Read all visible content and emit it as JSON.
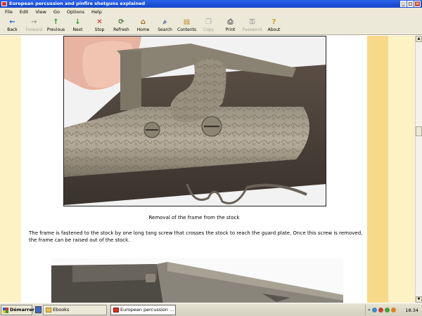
{
  "window": {
    "title": "European percussion and pinfire shotguns explained",
    "buttons": [
      "_",
      "□",
      "×"
    ]
  },
  "menu": [
    "File",
    "Edit",
    "View",
    "Go",
    "Options",
    "Help"
  ],
  "toolbar": [
    {
      "label": "Back",
      "icon": "←",
      "color": "#2a6bd0",
      "enabled": true
    },
    {
      "label": "Forward",
      "icon": "→",
      "color": "#9a9a9a",
      "enabled": false
    },
    {
      "label": "Previous",
      "icon": "↑",
      "color": "#28a028",
      "enabled": true
    },
    {
      "label": "Next",
      "icon": "↓",
      "color": "#28a028",
      "enabled": true
    },
    {
      "label": "Stop",
      "icon": "✕",
      "color": "#d82020",
      "enabled": true
    },
    {
      "label": "Refresh",
      "icon": "⟳",
      "color": "#3a7a3a",
      "enabled": true
    },
    {
      "label": "Home",
      "icon": "⌂",
      "color": "#a06a20",
      "enabled": true
    },
    {
      "label": "Search",
      "icon": "⌕",
      "color": "#2a4a8a",
      "enabled": true
    },
    {
      "label": "Contents",
      "icon": "▤",
      "color": "#b88830",
      "enabled": true
    },
    {
      "label": "Copy",
      "icon": "❐",
      "color": "#a8a8a8",
      "enabled": false
    },
    {
      "label": "Print",
      "icon": "⎙",
      "color": "#5a5a5a",
      "enabled": true
    },
    {
      "label": "Password",
      "icon": "⚿",
      "color": "#a8a8a8",
      "enabled": false
    },
    {
      "label": "About",
      "icon": "?",
      "color": "#c8a020",
      "enabled": true
    }
  ],
  "page": {
    "caption": "Removal of the frame from the stock",
    "paragraph": "The frame is fastened to the stock by one long tang screw that crosses the stock to reach the guard plate. Once this screw is removed, the frame can be raised out of the stock."
  },
  "taskbar": {
    "start_label": "Démarrer",
    "tasks": [
      {
        "label": "Ebooks",
        "active": false
      },
      {
        "label": "European percussion ...",
        "active": true
      }
    ],
    "clock": "18:34"
  }
}
